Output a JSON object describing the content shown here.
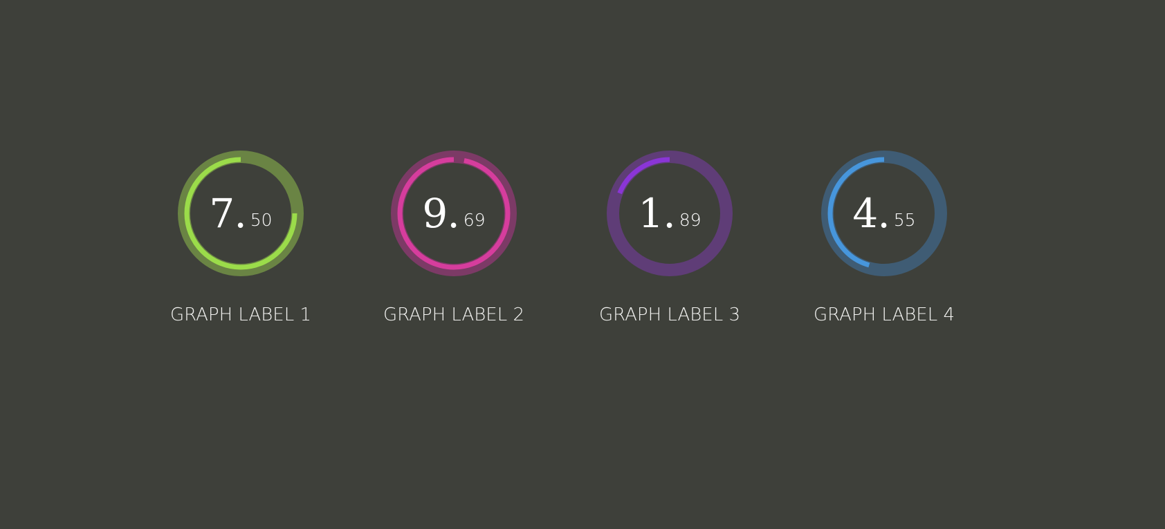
{
  "chart_data": {
    "type": "radial-gauge",
    "max": 10,
    "gauges": [
      {
        "label": "GRAPH LABEL 1",
        "integer": "7.",
        "decimal": "50",
        "value": 7.5,
        "color": "#9bdc4a",
        "track_color": "#6a8444"
      },
      {
        "label": "GRAPH LABEL 2",
        "integer": "9.",
        "decimal": "69",
        "value": 9.69,
        "color": "#d63d9d",
        "track_color": "#7c3a66"
      },
      {
        "label": "GRAPH LABEL 3",
        "integer": "1.",
        "decimal": "89",
        "value": 1.89,
        "color": "#8a35d6",
        "track_color": "#5f3d77"
      },
      {
        "label": "GRAPH LABEL 4",
        "integer": "4.",
        "decimal": "55",
        "value": 4.55,
        "color": "#4796dc",
        "track_color": "#3f5c74"
      }
    ]
  }
}
